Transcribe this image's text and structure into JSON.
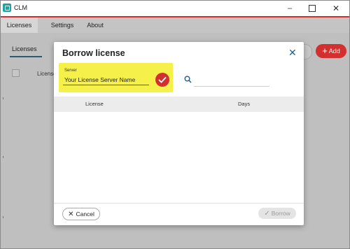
{
  "window": {
    "title": "CLM",
    "minimize_glyph": "–",
    "close_glyph": "✕"
  },
  "menu": {
    "items": [
      {
        "label": "Licenses"
      },
      {
        "label": "Settings"
      },
      {
        "label": "About"
      }
    ]
  },
  "background": {
    "tab_label": "Licenses",
    "add_label": "Add",
    "add_glyph": "+",
    "column_license": "License"
  },
  "dialog": {
    "title": "Borrow license",
    "close_glyph": "✕",
    "server": {
      "label": "Server",
      "value": "Your License Server Name"
    },
    "search": {
      "value": ""
    },
    "table": {
      "columns": [
        "License",
        "Days"
      ],
      "rows": []
    },
    "cancel_label": "Cancel",
    "cancel_glyph": "✕",
    "borrow_label": "Borrow",
    "borrow_glyph": "✓"
  },
  "colors": {
    "accent_red": "#d32f2f",
    "highlight_yellow": "#f6f04a",
    "icon_blue": "#1e5f86"
  }
}
